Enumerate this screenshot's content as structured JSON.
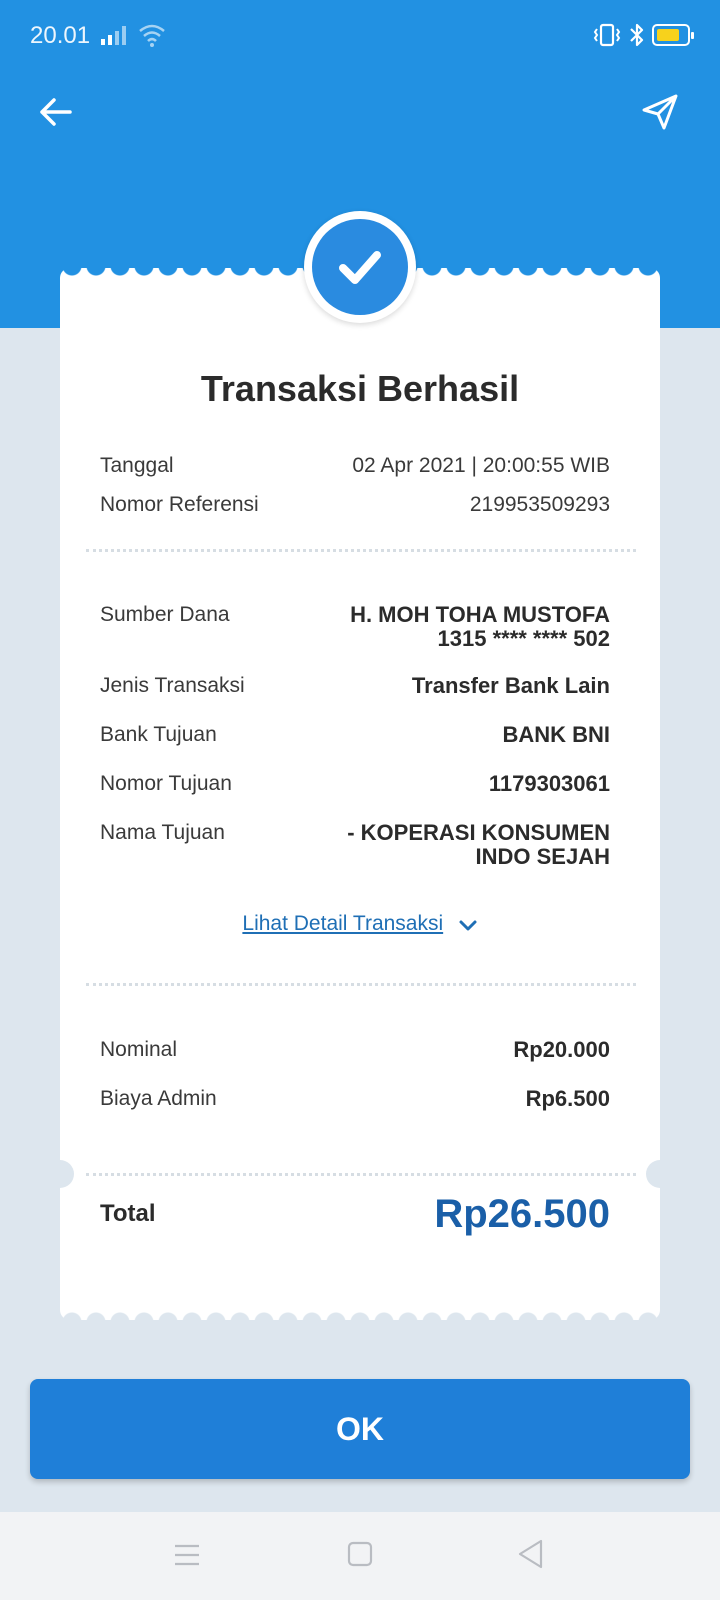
{
  "status_bar": {
    "time": "20.01",
    "icons": [
      "signal-icon",
      "wifi-icon",
      "vibrate-icon",
      "bluetooth-icon",
      "battery-icon"
    ]
  },
  "header": {
    "back_icon": "arrow-left-icon",
    "share_icon": "send-icon"
  },
  "receipt": {
    "status_icon": "check-icon",
    "title": "Transaksi Berhasil",
    "meta": [
      {
        "label": "Tanggal",
        "value": "02 Apr 2021 | 20:00:55 WIB"
      },
      {
        "label": "Nomor Referensi",
        "value": "219953509293"
      }
    ],
    "details": {
      "sumber_dana": {
        "label": "Sumber Dana",
        "name": "H. MOH TOHA MUSTOFA",
        "account": "1315 **** **** 502"
      },
      "jenis_transaksi": {
        "label": "Jenis Transaksi",
        "value": "Transfer Bank Lain"
      },
      "bank_tujuan": {
        "label": "Bank Tujuan",
        "value": "BANK BNI"
      },
      "nomor_tujuan": {
        "label": "Nomor Tujuan",
        "value": "1179303061"
      },
      "nama_tujuan": {
        "label": "Nama Tujuan",
        "line1": "- KOPERASI KONSUMEN",
        "line2": "INDO SEJAH"
      }
    },
    "detail_link": "Lihat Detail Transaksi",
    "amounts": {
      "nominal": {
        "label": "Nominal",
        "value": "Rp20.000"
      },
      "biaya_admin": {
        "label": "Biaya Admin",
        "value": "Rp6.500"
      }
    },
    "total": {
      "label": "Total",
      "value": "Rp26.500"
    }
  },
  "ok_button": "OK",
  "nav_bar": {
    "icons": [
      "menu-icon",
      "home-icon",
      "back-triangle-icon"
    ]
  },
  "colors": {
    "header_blue": "#2291e2",
    "button_blue": "#1f7fd8",
    "total_blue": "#1a5fa8",
    "link_blue": "#1f6fb5",
    "background": "#dde6ee"
  }
}
